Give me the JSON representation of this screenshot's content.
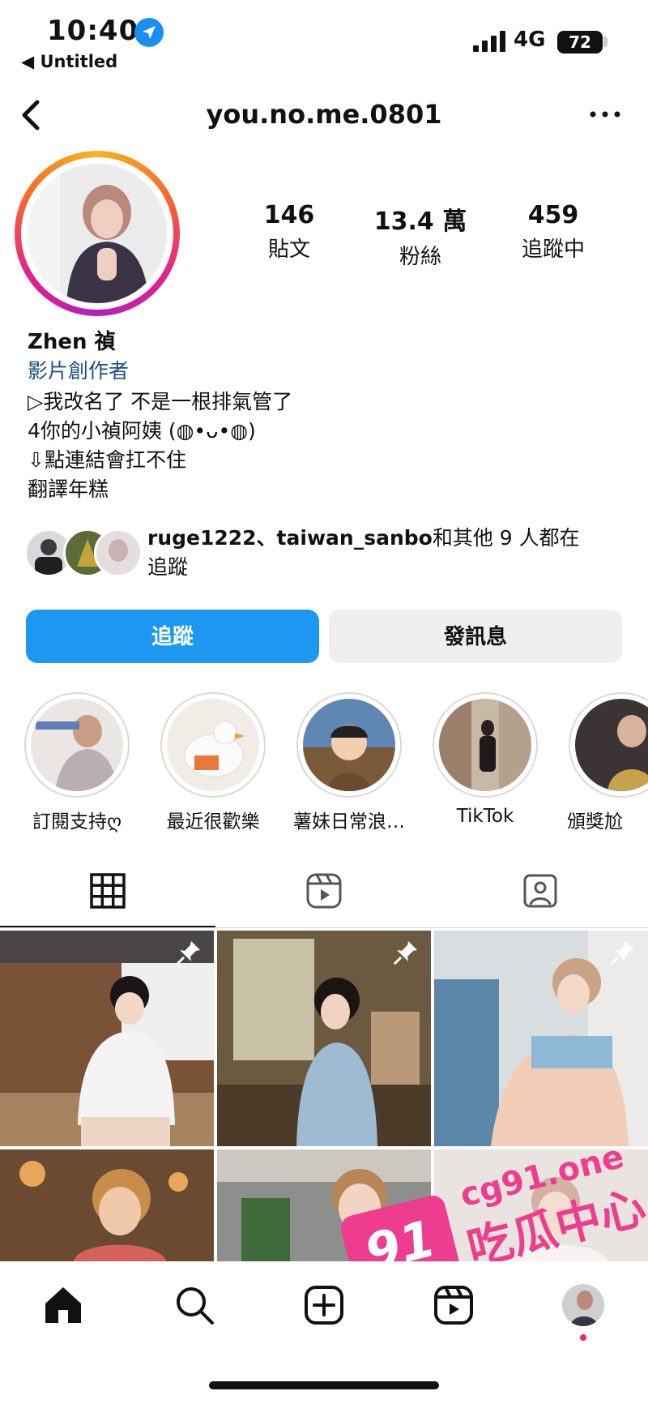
{
  "status_bar": {
    "time": "10:40",
    "back_app": "◀ Untitled",
    "network": "4G",
    "battery": "72"
  },
  "profile": {
    "username": "you.no.me.0801",
    "stats": [
      {
        "value": "146",
        "label": "貼文"
      },
      {
        "value": "13.4 萬",
        "label": "粉絲"
      },
      {
        "value": "459",
        "label": "追蹤中"
      }
    ],
    "name": "Zhen 禎",
    "category": "影片創作者",
    "bio_lines": [
      "▷我改名了 不是一根排氣管了",
      "4你的小禎阿姨 (◍•ᴗ•◍)",
      "⇩點連結會扛不住",
      "翻譯年糕"
    ],
    "mutual": {
      "users": "ruge1222、taiwan_sanbo",
      "rest": "和其他 9 人都在",
      "line2": "追蹤"
    }
  },
  "actions": {
    "follow": "追蹤",
    "message": "發訊息"
  },
  "highlights": [
    {
      "label": "訂閱支持ღ"
    },
    {
      "label": "最近很歡樂"
    },
    {
      "label": "薯妹日常浪…"
    },
    {
      "label": "TikTok"
    },
    {
      "label": "頒獎尬"
    }
  ],
  "tabs": [
    {
      "name": "grid-icon"
    },
    {
      "name": "reels-icon"
    },
    {
      "name": "tagged-icon"
    }
  ],
  "watermark": {
    "number": "91",
    "url": "cg91.one",
    "text": "吃瓜中心"
  },
  "colors": {
    "accent": "#1d97f0",
    "watermark": "#ee3d8f"
  }
}
